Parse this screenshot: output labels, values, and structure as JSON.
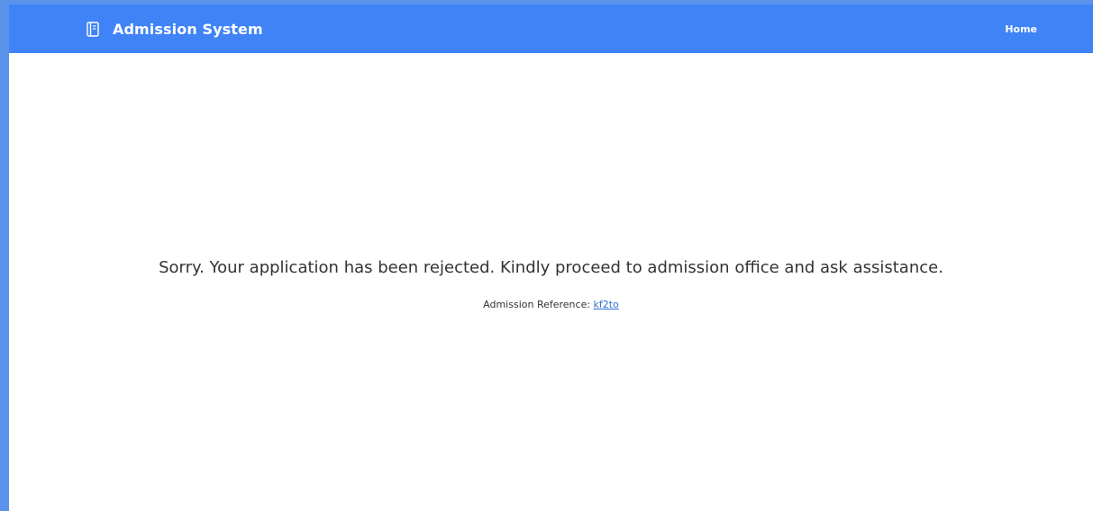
{
  "header": {
    "app_title": "Admission System",
    "brand_icon": "book-icon",
    "nav": {
      "home_label": "Home"
    }
  },
  "main": {
    "message": "Sorry. Your application has been rejected. Kindly proceed to admission office and ask assistance.",
    "reference_label": "Admission Reference:",
    "reference_code": "kf2to"
  },
  "colors": {
    "navbar": "#3f83f7",
    "frame_border": "#5b93ec",
    "link": "#2f6fd6",
    "text": "#333333"
  }
}
